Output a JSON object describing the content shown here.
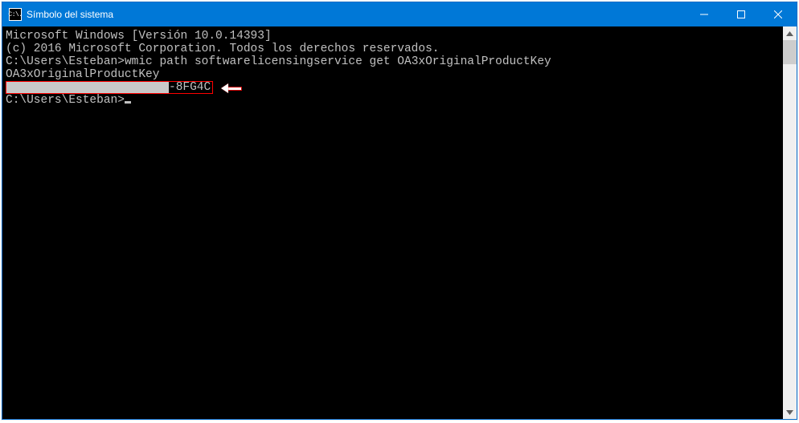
{
  "window": {
    "title": "Símbolo del sistema",
    "app_icon_text": "C:\\."
  },
  "terminal": {
    "line1": "Microsoft Windows [Versión 10.0.14393]",
    "line2": "(c) 2016 Microsoft Corporation. Todos los derechos reservados.",
    "blank": "",
    "prompt1_prefix": "C:\\Users\\Esteban>",
    "command": "wmic path softwarelicensingservice get OA3xOriginalProductKey",
    "header": "OA3xOriginalProductKey",
    "key_suffix": "-8FG4C",
    "prompt2": "C:\\Users\\Esteban>"
  }
}
